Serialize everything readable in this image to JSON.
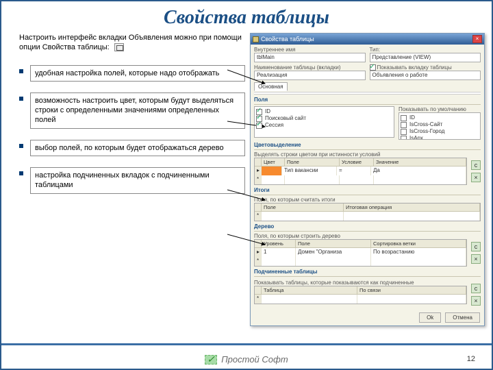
{
  "title": "Свойства таблицы",
  "intro": "Настроить интерфейс вкладки Объявления можно при помощи опции Свойства таблицы:",
  "bullets": [
    "удобная настройка полей, которые надо отображать",
    "возможность настроить цвет, которым будут выделяться строки с определенными значениями определенных полей",
    "выбор полей, по которым будет отображаться дерево",
    "настройка подчиненных вкладок с подчиненными таблицами"
  ],
  "screenshot": {
    "window_title": "Свойства таблицы",
    "name_label": "Внутреннее имя",
    "name_value": "tblMain",
    "type_label": "Тип:",
    "type_value": "Представление (VIEW)",
    "caption_label": "Наименование таблицы (вкладки)",
    "caption_value": "Реализация",
    "show_chk": "Показывать вкладку таблицы",
    "desc_value": "Объявления о работе",
    "tab": "Основная",
    "sect_fields": "Поля",
    "fields_hint": "Показывать по умолчанию",
    "left_list": [
      "ID",
      "Поисковый сайт",
      "Сессия"
    ],
    "right_list": [
      "ID",
      "IsCross-Сайт",
      "IsCross-Город",
      "IsАрх"
    ],
    "sect_colors": "Цветовыделение",
    "colors_hint": "Выделять строки цветом при истинности условий",
    "colors_cols": [
      "Цвет",
      "Поле",
      "Условие",
      "Значение"
    ],
    "colors_row": [
      "",
      "Тип вакансии",
      "=",
      "Да"
    ],
    "sect_totals": "Итоги",
    "totals_hint": "Поля, по которым считать итоги",
    "totals_cols": [
      "Поле",
      "Итоговая операция"
    ],
    "sect_tree": "Дерево",
    "tree_hint": "Поля, по которым строить дерево",
    "tree_cols": [
      "Уровень",
      "Поле",
      "Сортировка ветки"
    ],
    "tree_row": [
      "1",
      "Домен \"Организа",
      "По возрастанию"
    ],
    "sect_sub": "Подчиненные таблицы",
    "sub_hint": "Показывать таблицы, которые показываются как подчиненные",
    "sub_cols": [
      "Таблица",
      "По связи"
    ],
    "ok": "Ok",
    "cancel": "Отмена"
  },
  "brand": "Простой Софт",
  "page_number": "12"
}
